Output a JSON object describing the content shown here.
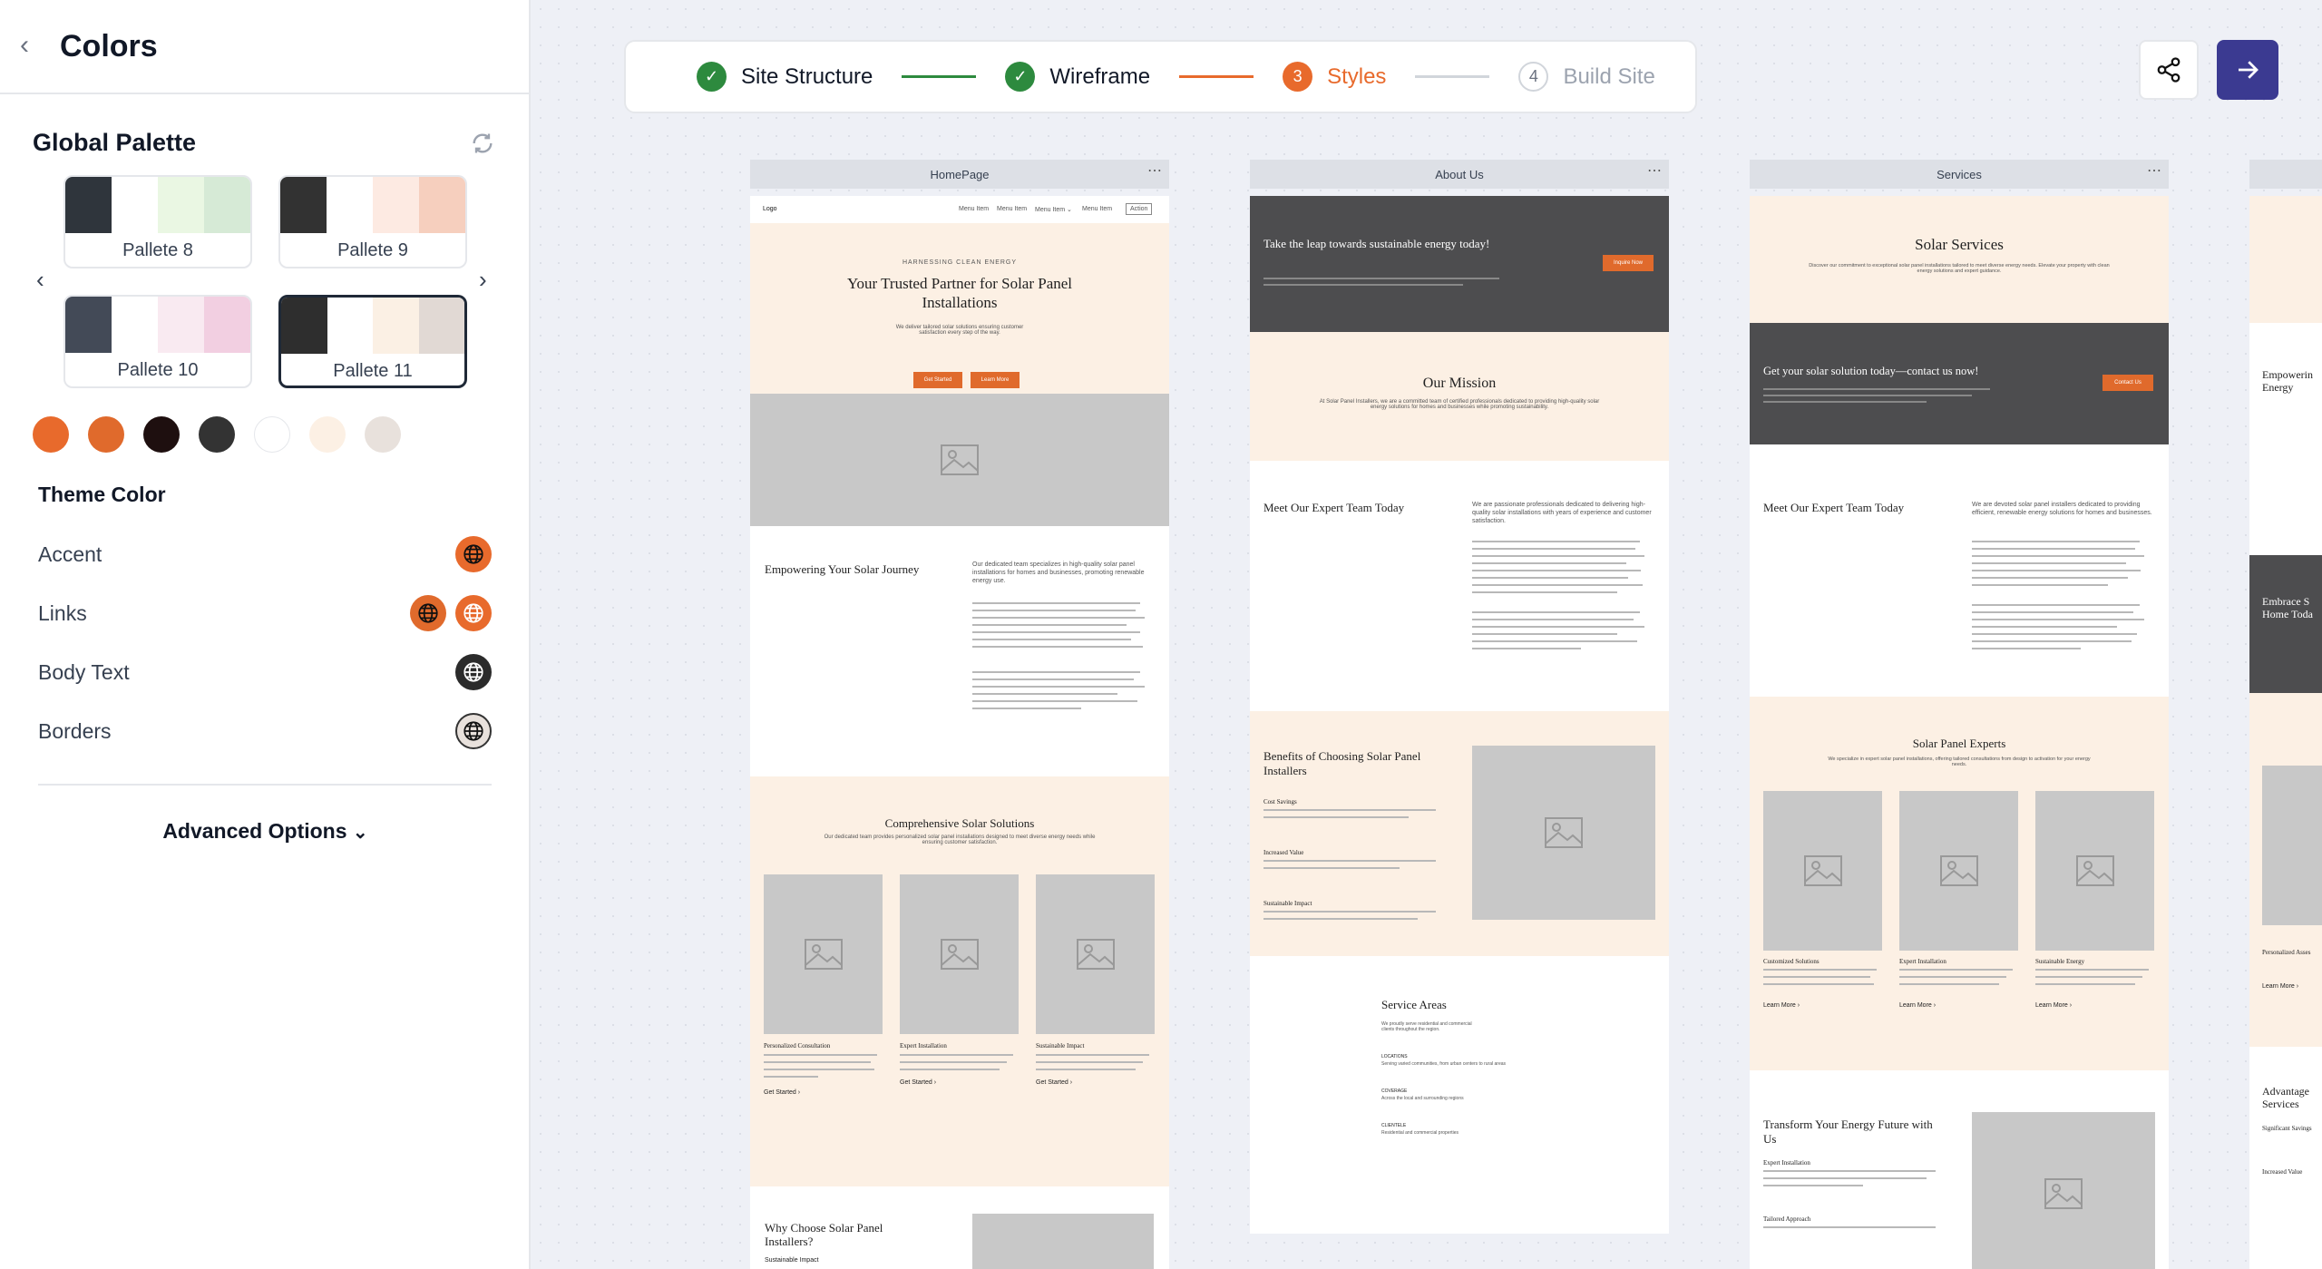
{
  "sidebar": {
    "title": "Colors",
    "global_palette_title": "Global Palette",
    "palettes": [
      {
        "label": "Pallete 8",
        "colors": [
          "#2f353c",
          "#ffffff",
          "#eaf7e3",
          "#d6ead6"
        ]
      },
      {
        "label": "Pallete 9",
        "colors": [
          "#323232",
          "#ffffff",
          "#fdeae2",
          "#f6cfbe"
        ]
      },
      {
        "label": "Pallete 10",
        "colors": [
          "#434a57",
          "#ffffff",
          "#f9eaf1",
          "#f2cfe1"
        ]
      },
      {
        "label": "Pallete 11",
        "colors": [
          "#2e2e2e",
          "#ffffff",
          "#fbf0e4",
          "#e1d9d4"
        ]
      }
    ],
    "swatches": [
      "#e86a2c",
      "#e06a2c",
      "#1e0f0f",
      "#333333",
      "#ffffff",
      "#fcf0e4",
      "#e8e1dc"
    ],
    "theme_title": "Theme Color",
    "theme_rows": [
      {
        "label": "Accent"
      },
      {
        "label": "Links"
      },
      {
        "label": "Body Text"
      },
      {
        "label": "Borders"
      }
    ],
    "advanced_label": "Advanced Options"
  },
  "stepper": [
    {
      "num": "✓",
      "label": "Site Structure",
      "state": "done"
    },
    {
      "num": "✓",
      "label": "Wireframe",
      "state": "done"
    },
    {
      "num": "3",
      "label": "Styles",
      "state": "active"
    },
    {
      "num": "4",
      "label": "Build Site",
      "state": "todo"
    }
  ],
  "pages": {
    "home": {
      "name": "HomePage",
      "logo": "Logo",
      "nav": [
        "Menu Item",
        "Menu Item",
        "Menu Item ⌄",
        "Menu Item"
      ],
      "nav_action": "Action",
      "eyebrow": "HARNESSING CLEAN ENERGY",
      "hero_title": "Your Trusted Partner for Solar Panel Installations",
      "hero_text": "We deliver tailored solar solutions ensuring customer satisfaction every step of the way.",
      "btn1": "Get Started",
      "btn2": "Learn More",
      "journey_title": "Empowering Your Solar Journey",
      "journey_text": "Our dedicated team specializes in high-quality solar panel installations for homes and businesses, promoting renewable energy use.",
      "solutions_title": "Comprehensive Solar Solutions",
      "solutions_text": "Our dedicated team provides personalized solar panel installations designed to meet diverse energy needs while ensuring customer satisfaction.",
      "cards": [
        {
          "title": "Personalized Consultation",
          "link": "Get Started ›"
        },
        {
          "title": "Expert Installation",
          "link": "Get Started ›"
        },
        {
          "title": "Sustainable Impact",
          "link": "Get Started ›"
        }
      ],
      "why_title": "Why Choose Solar Panel Installers?",
      "why_sub": "Sustainable Impact"
    },
    "about": {
      "name": "About Us",
      "banner_title": "Take the leap towards sustainable energy today!",
      "banner_btn": "Inquire Now",
      "mission_title": "Our Mission",
      "mission_text": "At Solar Panel Installers, we are a committed team of certified professionals dedicated to providing high-quality solar energy solutions for homes and businesses while promoting sustainability.",
      "team_title": "Meet Our Expert Team Today",
      "team_text": "We are passionate professionals dedicated to delivering high-quality solar installations with years of experience and customer satisfaction.",
      "benefits_title": "Benefits of Choosing Solar Panel Installers",
      "benefits": [
        "Cost Savings",
        "Increased Value",
        "Sustainable Impact"
      ],
      "areas_title": "Service Areas",
      "areas_text": "We proudly serve residential and commercial clients throughout the region.",
      "areas": [
        {
          "label": "LOCATIONS",
          "text": "Serving varied communities, from urban centers to rural areas"
        },
        {
          "label": "COVERAGE",
          "text": "Across the local and surrounding regions"
        },
        {
          "label": "CLIENTELE",
          "text": "Residential and commercial properties"
        }
      ]
    },
    "services": {
      "name": "Services",
      "hero_title": "Solar Services",
      "hero_text": "Discover our commitment to exceptional solar panel installations tailored to meet diverse energy needs. Elevate your property with clean energy solutions and expert guidance.",
      "banner_title": "Get your solar solution today—contact us now!",
      "banner_btn": "Contact Us",
      "team_title": "Meet Our Expert Team Today",
      "team_text": "We are devoted solar panel installers dedicated to providing efficient, renewable energy solutions for homes and businesses.",
      "experts_title": "Solar Panel Experts",
      "experts_text": "We specialize in expert solar panel installations, offering tailored consultations from design to activation for your energy needs.",
      "cards": [
        {
          "title": "Customized Solutions",
          "link": "Learn More ›"
        },
        {
          "title": "Expert Installation",
          "link": "Learn More ›"
        },
        {
          "title": "Sustainable Energy",
          "link": "Learn More ›"
        }
      ],
      "transform_title": "Transform Your Energy Future with Us",
      "transform_items": [
        "Expert Installation",
        "Tailored Approach"
      ]
    },
    "partial": {
      "text1": "Empowerin Energy",
      "text2": "Embrace S Home Toda",
      "text3": "Advantage Services",
      "sub1": "Significant Savings",
      "sub2": "Increased Value",
      "sub3": "Personalized Asses",
      "link": "Learn More ›"
    }
  },
  "colors": {
    "accent": "#e86a2c",
    "primary": "#3b3a91",
    "done": "#2d8a3e"
  }
}
